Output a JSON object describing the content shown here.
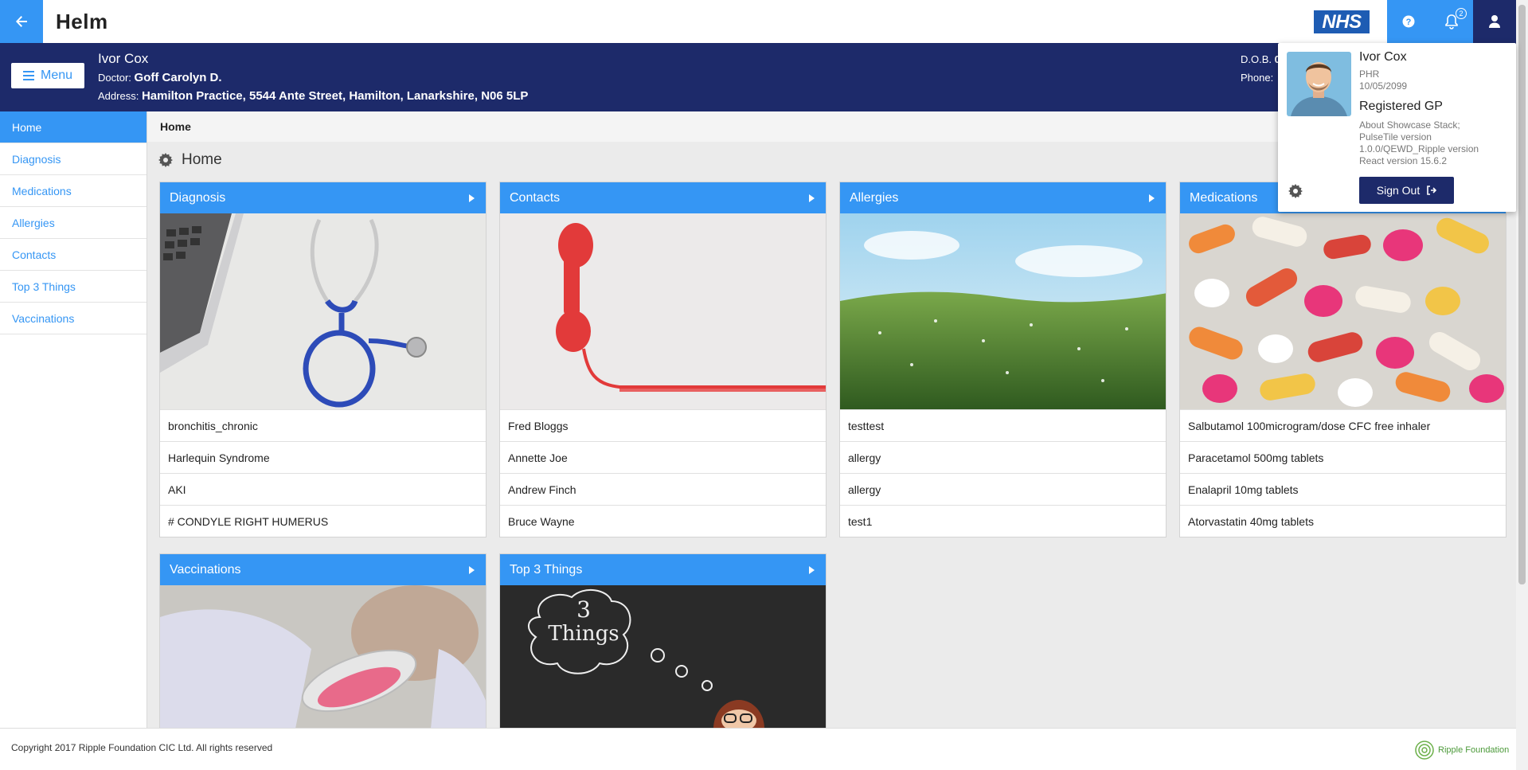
{
  "app": {
    "logo": "Helm",
    "nhs_logo": "NHS",
    "notifications_count": "2"
  },
  "patient": {
    "name": "Ivor Cox",
    "doctor_label": "Doctor:",
    "doctor": "Goff Carolyn D.",
    "address_label": "Address:",
    "address": "Hamilton Practice, 5544 Ante Street, Hamilton, Lanarkshire, N06 5LP",
    "dob_label": "D.O.B.",
    "dob_value": "0",
    "phone_label": "Phone:"
  },
  "menu_button": "Menu",
  "sidebar": {
    "items": [
      {
        "label": "Home",
        "active": true
      },
      {
        "label": "Diagnosis"
      },
      {
        "label": "Medications"
      },
      {
        "label": "Allergies"
      },
      {
        "label": "Contacts"
      },
      {
        "label": "Top 3 Things"
      },
      {
        "label": "Vaccinations"
      }
    ]
  },
  "breadcrumb": "Home",
  "page_title": "Home",
  "tiles": [
    {
      "title": "Diagnosis",
      "rows": [
        "bronchitis_chronic",
        "Harlequin Syndrome",
        "AKI",
        "# CONDYLE RIGHT HUMERUS"
      ]
    },
    {
      "title": "Contacts",
      "rows": [
        "Fred Bloggs",
        "Annette Joe",
        "Andrew Finch",
        "Bruce Wayne"
      ]
    },
    {
      "title": "Allergies",
      "rows": [
        "testtest",
        "allergy",
        "allergy",
        "test1"
      ]
    },
    {
      "title": "Medications",
      "rows": [
        "Salbutamol 100microgram/dose CFC free inhaler",
        "Paracetamol 500mg tablets",
        "Enalapril 10mg tablets",
        "Atorvastatin 40mg tablets"
      ]
    },
    {
      "title": "Vaccinations",
      "rows": []
    },
    {
      "title": "Top 3 Things",
      "rows": [],
      "image_text": [
        "3",
        "Things"
      ]
    }
  ],
  "user_popup": {
    "name": "Ivor Cox",
    "role": "PHR",
    "date": "10/05/2099",
    "gp": "Registered GP",
    "about": [
      "About Showcase Stack;",
      "PulseTile version",
      "1.0.0/QEWD_Ripple version",
      "React version 15.6.2"
    ],
    "sign_out": "Sign Out"
  },
  "footer": {
    "copyright": "Copyright 2017 Ripple Foundation CIC Ltd. All rights reserved",
    "ripple": "Ripple Foundation"
  },
  "colors": {
    "primary": "#3596f4",
    "navy": "#1d2a6a",
    "background": "#ebebeb"
  }
}
